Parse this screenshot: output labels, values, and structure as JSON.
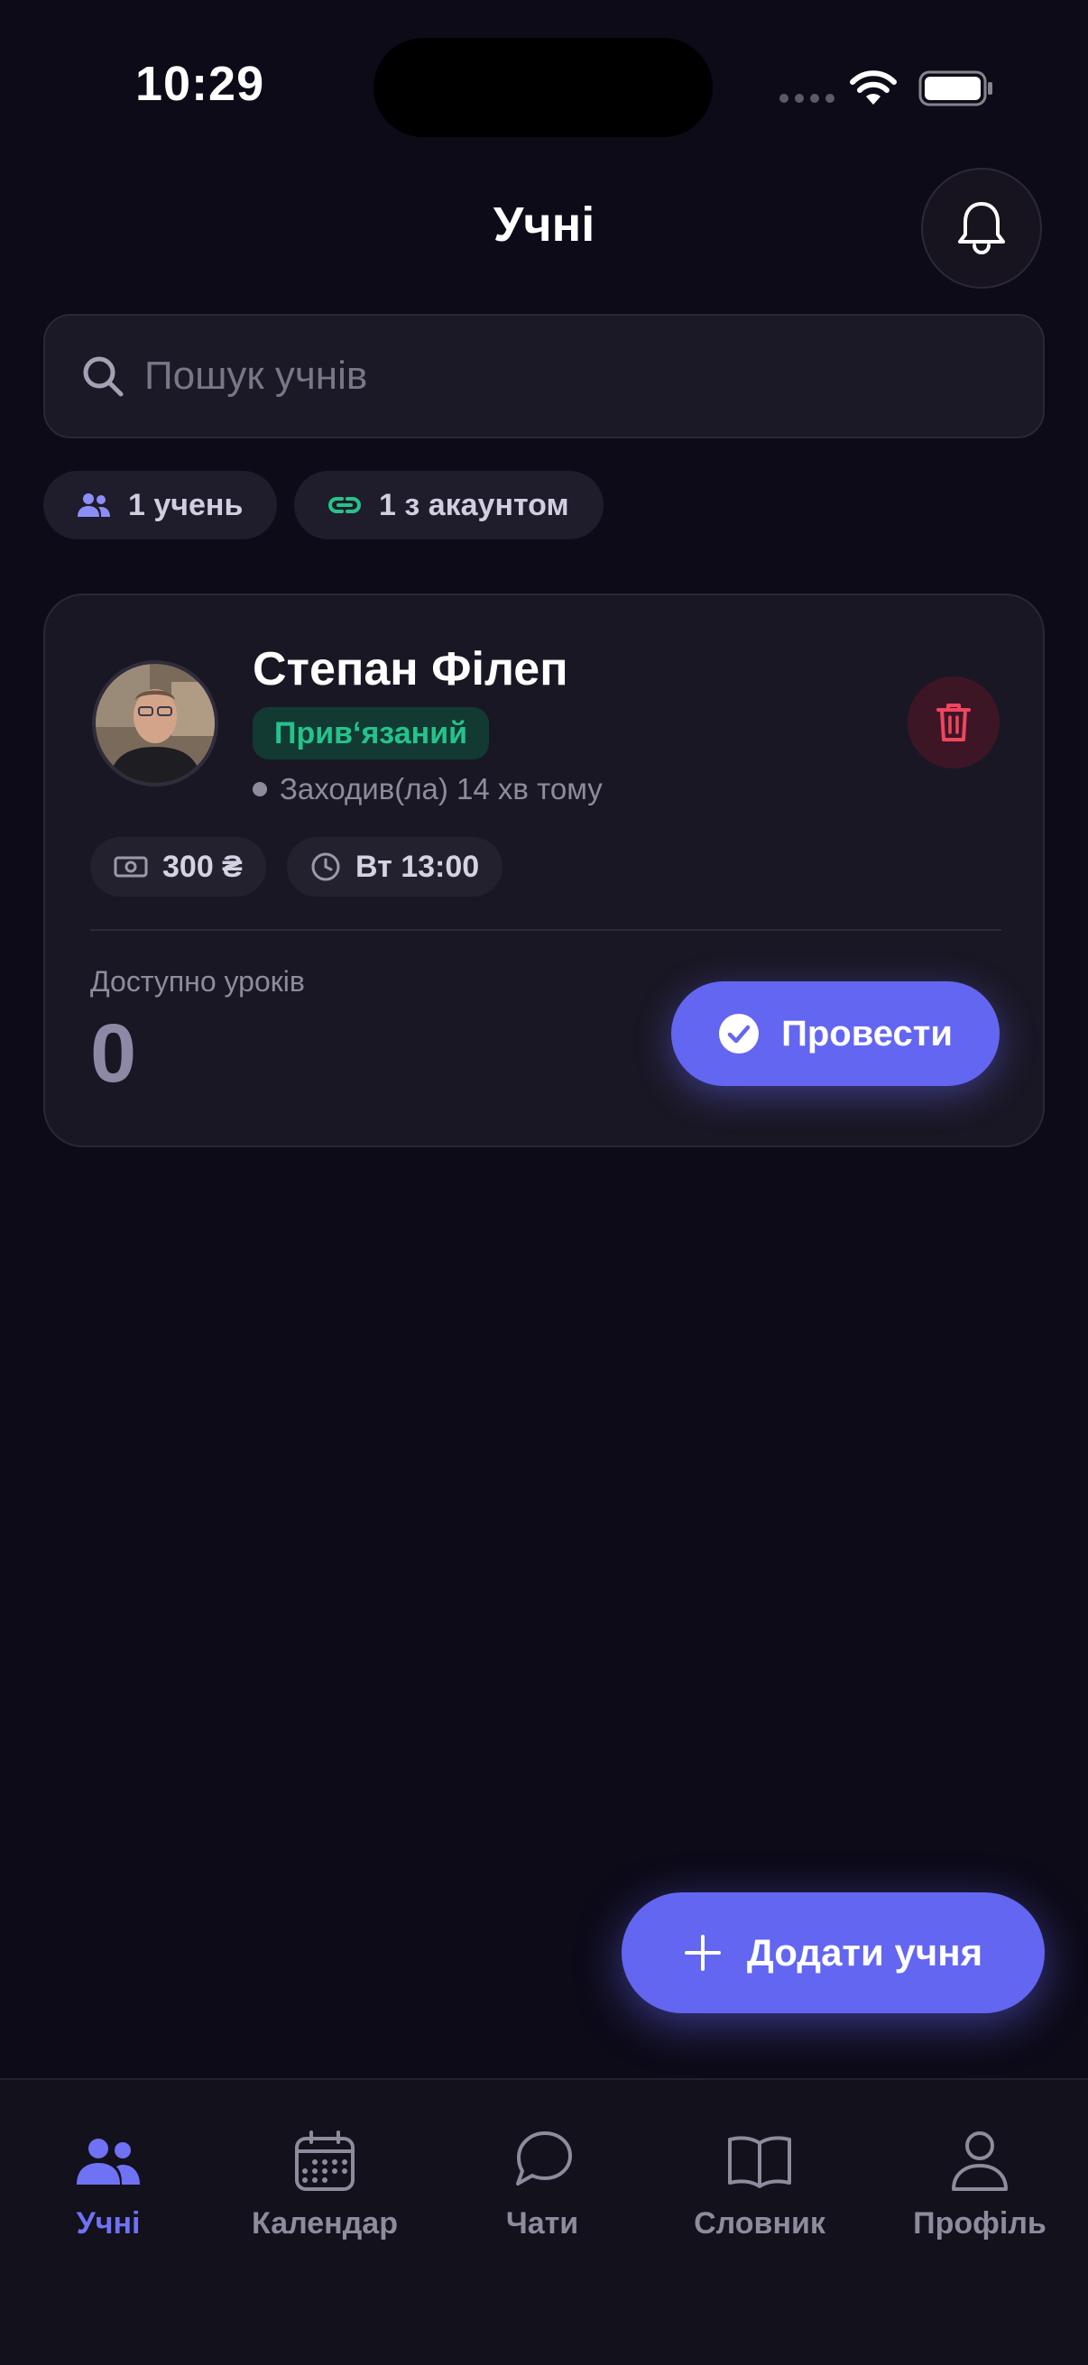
{
  "status_bar": {
    "time": "10:29"
  },
  "header": {
    "title": "Учні"
  },
  "search": {
    "placeholder": "Пошук учнів"
  },
  "summary_chips": {
    "students": "1 учень",
    "with_account": "1 з акаунтом"
  },
  "student_card": {
    "name": "Степан Філеп",
    "badge": "Прив‘язаний",
    "last_seen": "Заходив(ла) 14 хв тому",
    "price": "300 ₴",
    "schedule": "Вт 13:00",
    "lessons_label": "Доступно уроків",
    "lessons_value": "0",
    "conduct_label": "Провести"
  },
  "fab": {
    "label": "Додати учня"
  },
  "tabs": [
    {
      "label": "Учні",
      "icon": "users-icon",
      "active": true
    },
    {
      "label": "Календар",
      "icon": "calendar-icon",
      "active": false
    },
    {
      "label": "Чати",
      "icon": "chat-icon",
      "active": false
    },
    {
      "label": "Словник",
      "icon": "book-icon",
      "active": false
    },
    {
      "label": "Профіль",
      "icon": "user-icon",
      "active": false
    }
  ],
  "colors": {
    "background": "#0d0b18",
    "accent": "#6366f1",
    "success": "#25c38b",
    "danger": "#f0455f"
  }
}
